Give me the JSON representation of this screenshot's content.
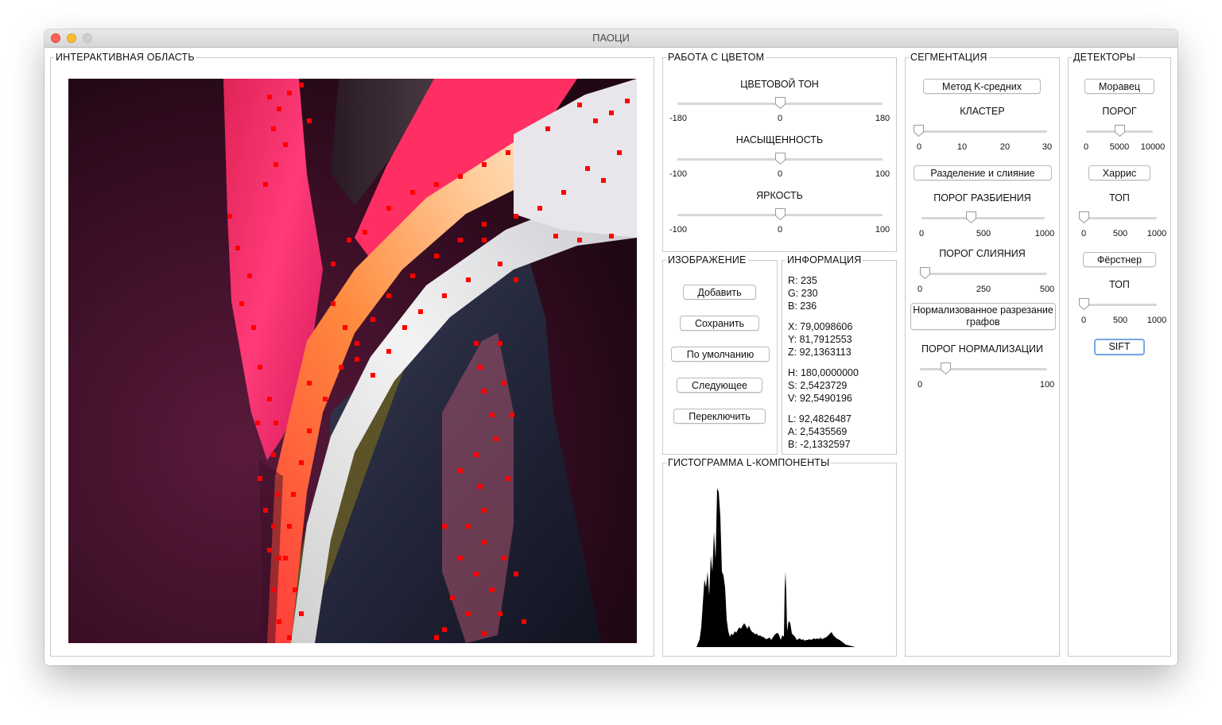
{
  "window": {
    "title": "ПАОЦИ"
  },
  "interactive": {
    "legend": "ИНТЕРАКТИВНАЯ ОБЛАСТЬ"
  },
  "color": {
    "legend": "РАБОТА С ЦВЕТОМ",
    "hue": {
      "label": "ЦВЕТОВОЙ ТОН",
      "min": "-180",
      "mid": "0",
      "max": "180",
      "value": 0
    },
    "saturation": {
      "label": "НАСЫЩЕННОСТЬ",
      "min": "-100",
      "mid": "0",
      "max": "100",
      "value": 0
    },
    "brightness": {
      "label": "ЯРКОСТЬ",
      "min": "-100",
      "mid": "0",
      "max": "100",
      "value": 0
    }
  },
  "image": {
    "legend": "ИЗОБРАЖЕНИЕ",
    "add": "Добавить",
    "save": "Сохранить",
    "default": "По умолчанию",
    "next": "Следующее",
    "toggle": "Переключить"
  },
  "info": {
    "legend": "ИНФОРМАЦИЯ",
    "r": "R: 235",
    "g": "G: 230",
    "b": "B: 236",
    "x": "X: 79,0098606",
    "y": "Y: 81,7912553",
    "z": "Z: 92,1363113",
    "h": "H: 180,0000000",
    "s": "S: 2,5423729",
    "v": "V: 92,5490196",
    "l": "L: 92,4826487",
    "a": "A: 2,5435569",
    "bb": "B: -2,1332597"
  },
  "histogram": {
    "legend": "ГИСТОГРАММА L-КОМПОНЕНТЫ"
  },
  "segmentation": {
    "legend": "СЕГМЕНТАЦИЯ",
    "kmeans": "Метод K-средних",
    "cluster": {
      "label": "КЛАСТЕР",
      "t0": "0",
      "t1": "10",
      "t2": "20",
      "t3": "30",
      "value": 0
    },
    "split_merge": "Разделение и слияние",
    "split": {
      "label": "ПОРОГ РАЗБИЕНИЯ",
      "t0": "0",
      "t1": "500",
      "t2": "1000",
      "value": 400
    },
    "merge": {
      "label": "ПОРОГ СЛИЯНИЯ",
      "t0": "0",
      "t1": "250",
      "t2": "500",
      "value": 20
    },
    "ncut": "Нормализованное разрезание графов",
    "norm": {
      "label": "ПОРОГ НОРМАЛИЗАЦИИ",
      "t0": "0",
      "t1": "100",
      "value": 20
    }
  },
  "detectors": {
    "legend": "ДЕТЕКТОРЫ",
    "moravec": "Моравец",
    "threshold": {
      "label": "ПОРОГ",
      "t0": "0",
      "t1": "5000",
      "t2": "10000",
      "value": 5000
    },
    "harris": "Харрис",
    "top1": {
      "label": "ТОП",
      "t0": "0",
      "t1": "500",
      "t2": "1000",
      "value": 0
    },
    "forstner": "Фёрстнер",
    "top2": {
      "label": "ТОП",
      "t0": "0",
      "t1": "500",
      "t2": "1000",
      "value": 0
    },
    "sift": "SIFT"
  }
}
